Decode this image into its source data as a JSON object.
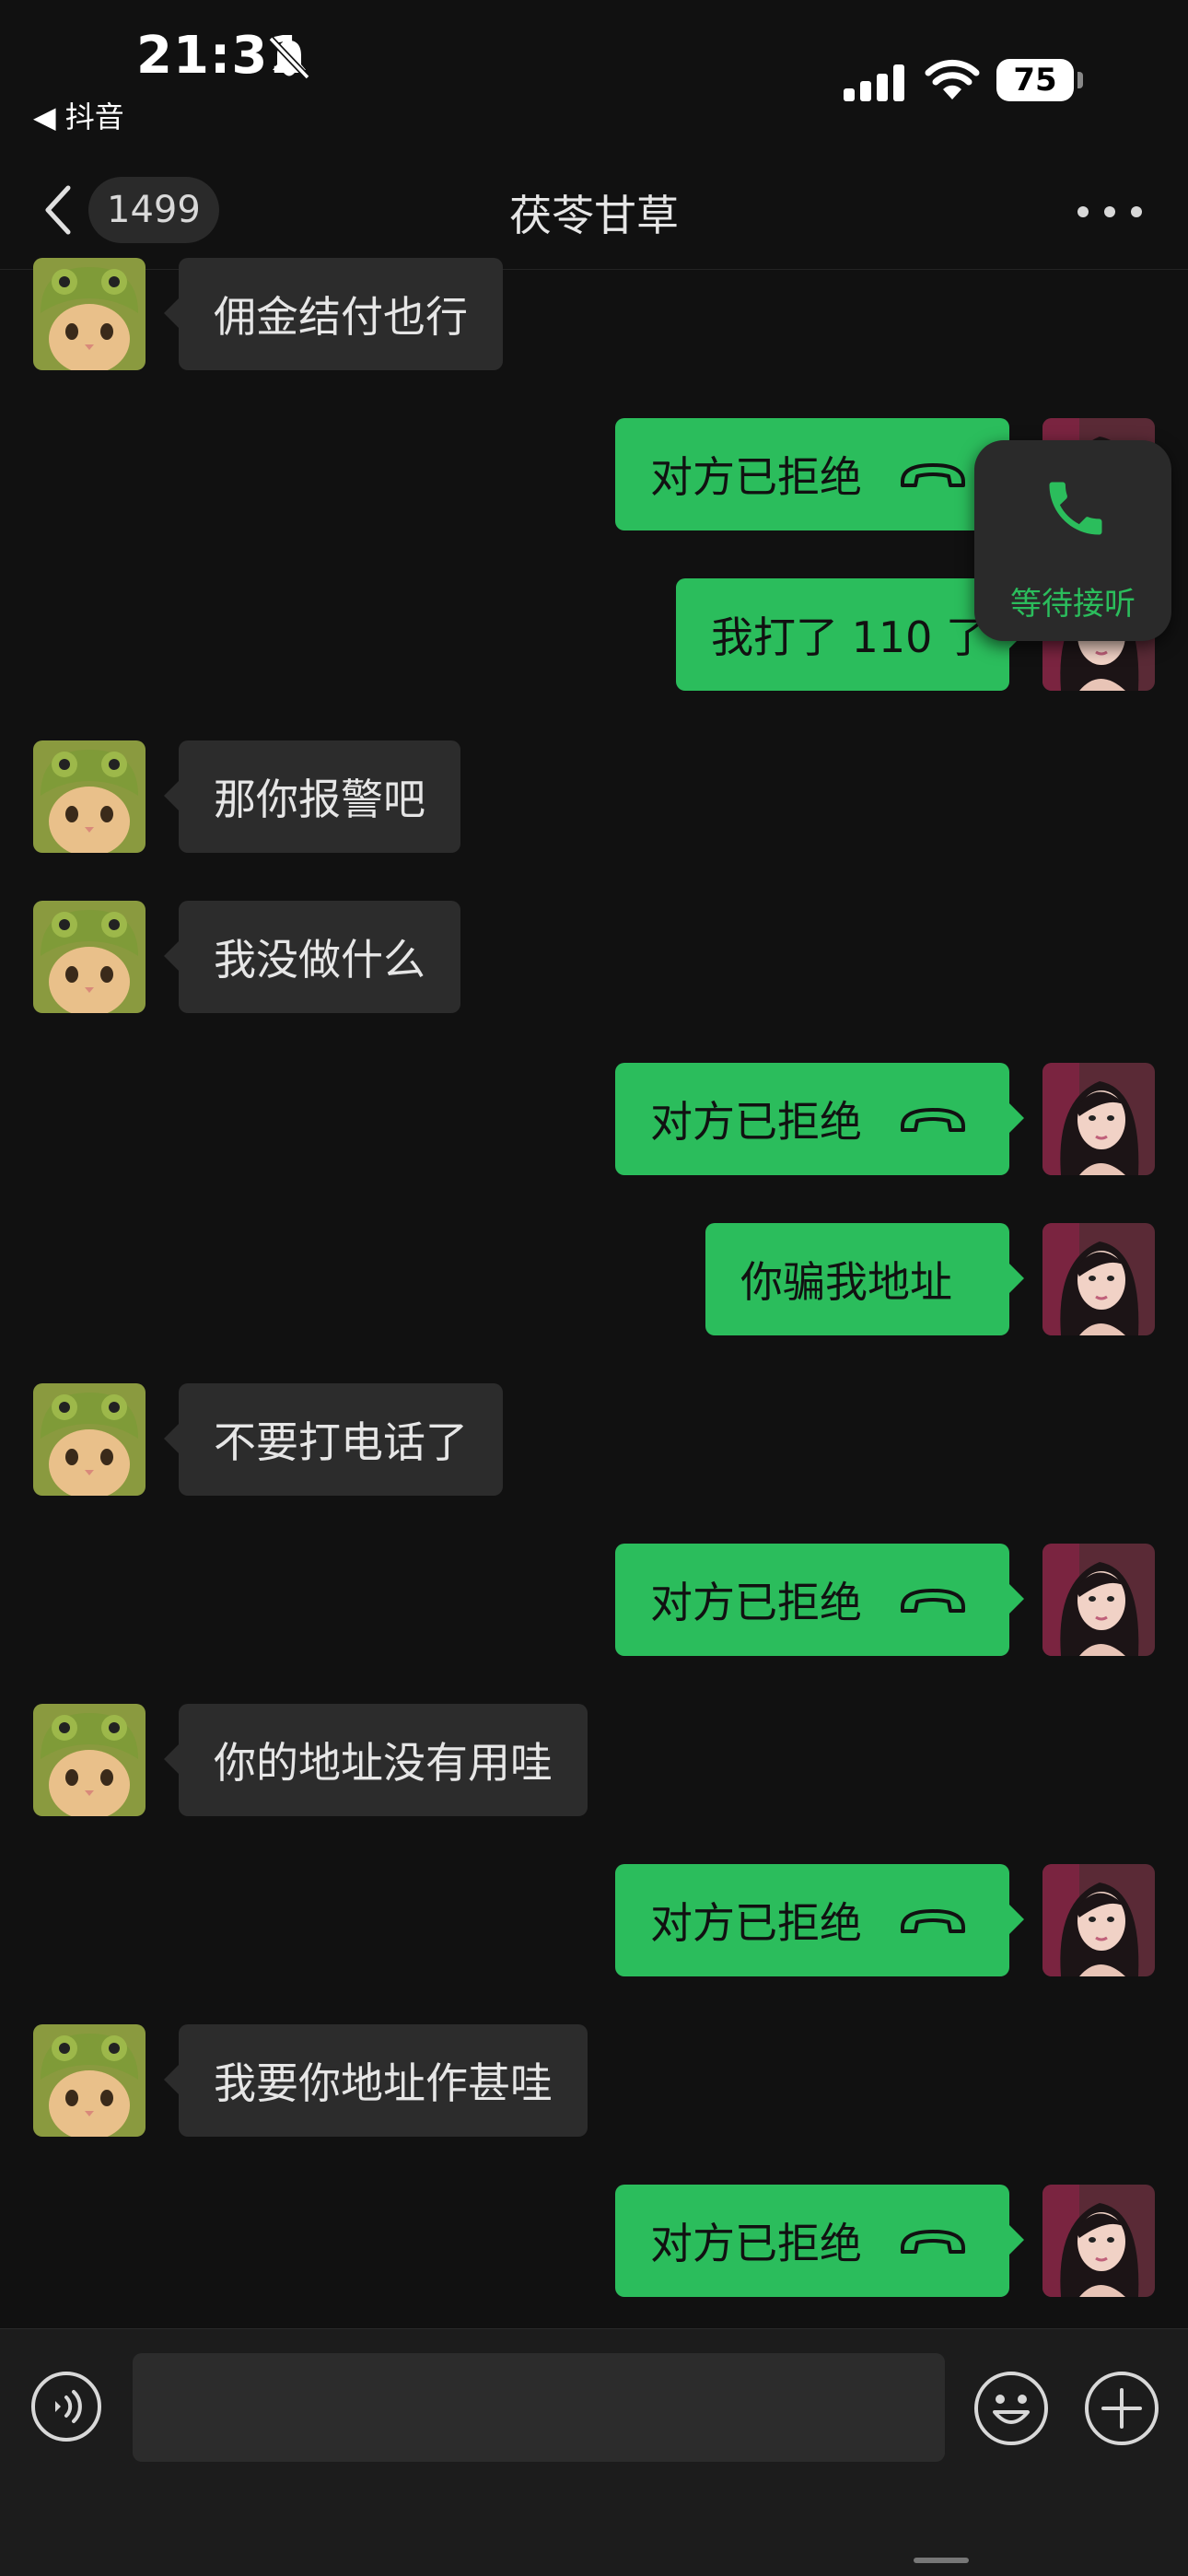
{
  "status_bar": {
    "time": "21:31",
    "back_app": "◀ 抖音",
    "battery": "75"
  },
  "nav": {
    "unread_count": "1499",
    "title": "茯苓甘草"
  },
  "messages": [
    {
      "side": "in",
      "text": "佣金结付也行"
    },
    {
      "side": "out",
      "text": "对方已拒绝",
      "call": true
    },
    {
      "side": "out",
      "text": "我打了 110 了"
    },
    {
      "side": "in",
      "text": "那你报警吧"
    },
    {
      "side": "in",
      "text": "我没做什么"
    },
    {
      "side": "out",
      "text": "对方已拒绝",
      "call": true
    },
    {
      "side": "out",
      "text": "你骗我地址"
    },
    {
      "side": "in",
      "text": "不要打电话了"
    },
    {
      "side": "out",
      "text": "对方已拒绝",
      "call": true
    },
    {
      "side": "in",
      "text": "你的地址没有用哇"
    },
    {
      "side": "out",
      "text": "对方已拒绝",
      "call": true
    },
    {
      "side": "in",
      "text": "我要你地址作甚哇"
    },
    {
      "side": "out",
      "text": "对方已拒绝",
      "call": true
    }
  ],
  "call_widget": {
    "label": "等待接听"
  },
  "input": {
    "value": "",
    "placeholder": ""
  },
  "colors": {
    "background": "#111111",
    "incoming_bubble": "#2c2c2c",
    "outgoing_bubble": "#2bbd5c",
    "accent": "#2bbd5c"
  },
  "icons": [
    "bell-slash-icon",
    "signal-icon",
    "wifi-icon",
    "battery-icon",
    "back-chevron-icon",
    "more-icon",
    "phone-icon",
    "hangup-icon",
    "voice-icon",
    "emoji-icon",
    "plus-icon"
  ]
}
